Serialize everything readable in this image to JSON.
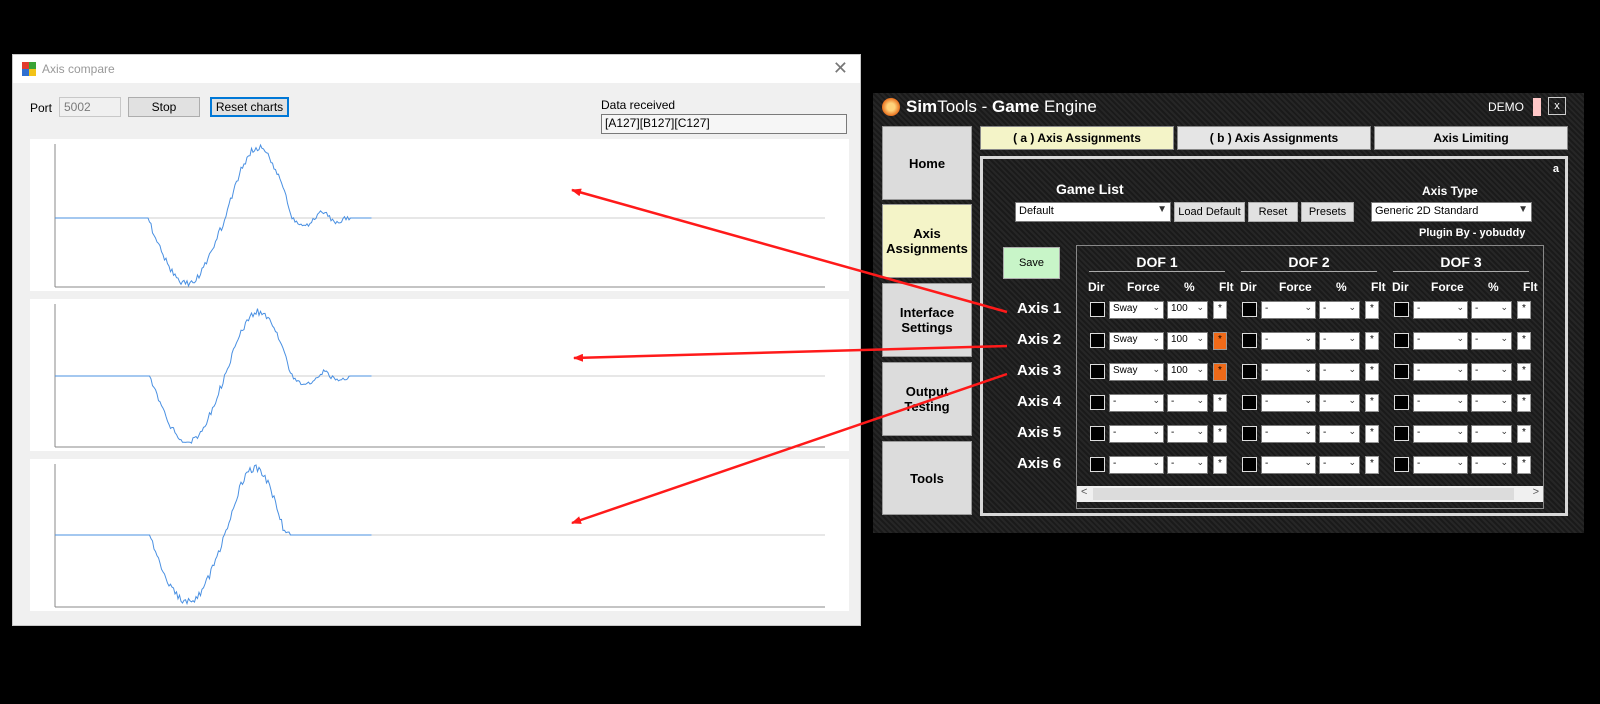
{
  "axis_compare": {
    "title": "Axis compare",
    "port_label": "Port",
    "port_value": "5002",
    "stop_label": "Stop",
    "reset_label": "Reset charts",
    "data_received_label": "Data received",
    "data_received_value": "[A127][B127][C127]",
    "line_color": "#4a90e2"
  },
  "simtools": {
    "title_sim": "Sim",
    "title_tools": "Tools - ",
    "title_game": "Game",
    "title_engine": " Engine",
    "demo": "DEMO",
    "close": "x",
    "nav": [
      {
        "label": "Home"
      },
      {
        "label": "Axis Assignments"
      },
      {
        "label": "Interface Settings"
      },
      {
        "label": "Output Testing"
      },
      {
        "label": "Tools"
      }
    ],
    "tabs": [
      {
        "label": "( a ) Axis Assignments"
      },
      {
        "label": "( b ) Axis Assignments"
      },
      {
        "label": "Axis Limiting"
      }
    ],
    "panel_letter": "a",
    "game_list_label": "Game List",
    "game_list_value": "Default",
    "load_default": "Load Default",
    "reset": "Reset",
    "presets": "Presets",
    "axis_type_label": "Axis Type",
    "axis_type_value": "Generic 2D Standard",
    "plugin_by": "Plugin By - yobuddy",
    "save": "Save",
    "dof_headers": [
      "DOF 1",
      "DOF 2",
      "DOF 3"
    ],
    "col_headers": {
      "dir": "Dir",
      "force": "Force",
      "pct": "%",
      "flt": "Flt"
    },
    "axes": [
      {
        "label": "Axis 1",
        "dof1_force": "Sway",
        "dof1_pct": "100",
        "dof1_flt_on": false
      },
      {
        "label": "Axis 2",
        "dof1_force": "Sway",
        "dof1_pct": "100",
        "dof1_flt_on": true
      },
      {
        "label": "Axis 3",
        "dof1_force": "Sway",
        "dof1_pct": "100",
        "dof1_flt_on": true
      },
      {
        "label": "Axis 4",
        "dof1_force": "-",
        "dof1_pct": "-",
        "dof1_flt_on": false
      },
      {
        "label": "Axis 5",
        "dof1_force": "-",
        "dof1_pct": "-",
        "dof1_flt_on": false
      },
      {
        "label": "Axis 6",
        "dof1_force": "-",
        "dof1_pct": "-",
        "dof1_flt_on": false
      }
    ],
    "empty_value": "-",
    "flt_glyph": "*",
    "accent_flt": "#f06a18",
    "arrow_color": "#ff1a1a"
  }
}
